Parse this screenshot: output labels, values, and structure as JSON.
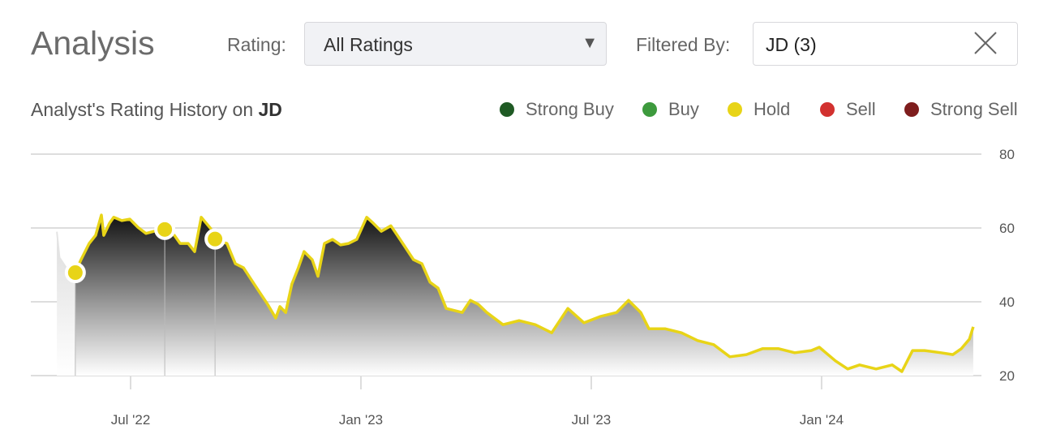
{
  "header": {
    "title": "Analysis",
    "rating_label": "Rating:",
    "rating_value": "All Ratings",
    "filter_label": "Filtered By:",
    "filter_value": "JD (3)"
  },
  "chart_title": {
    "prefix": "Analyst's Rating History on ",
    "ticker": "JD"
  },
  "legend": [
    {
      "label": "Strong Buy",
      "color": "#1f5a24"
    },
    {
      "label": "Buy",
      "color": "#3d9a3d"
    },
    {
      "label": "Hold",
      "color": "#e8d417"
    },
    {
      "label": "Sell",
      "color": "#d2312f"
    },
    {
      "label": "Strong Sell",
      "color": "#7e1d1d"
    }
  ],
  "chart_data": {
    "type": "line",
    "title": "Analyst's Rating History on JD",
    "x_unit": "months since Jul 2022",
    "xlim": [
      -1.92,
      21.95
    ],
    "ylim": [
      20,
      80
    ],
    "yticks": [
      20,
      40,
      60,
      80
    ],
    "xticks": [
      {
        "x": 0,
        "label": "Jul '22"
      },
      {
        "x": 6,
        "label": "Jan '23"
      },
      {
        "x": 12,
        "label": "Jul '23"
      },
      {
        "x": 18,
        "label": "Jan '24"
      }
    ],
    "line_color": "#e8d417",
    "pre_series": [
      [
        -1.92,
        59
      ],
      [
        -1.85,
        52
      ],
      [
        -1.6,
        48
      ],
      [
        -1.44,
        47.9
      ]
    ],
    "series": [
      [
        -1.44,
        47.9
      ],
      [
        -1.29,
        51.4
      ],
      [
        -1.08,
        55.8
      ],
      [
        -0.91,
        58
      ],
      [
        -0.76,
        63.5
      ],
      [
        -0.7,
        58
      ],
      [
        -0.55,
        61.3
      ],
      [
        -0.44,
        62.9
      ],
      [
        -0.23,
        62
      ],
      [
        -0.02,
        62.4
      ],
      [
        0.19,
        60.2
      ],
      [
        0.4,
        58.5
      ],
      [
        0.61,
        59.1
      ],
      [
        0.89,
        59.6
      ],
      [
        1.14,
        58
      ],
      [
        1.29,
        55.8
      ],
      [
        1.5,
        55.8
      ],
      [
        1.67,
        53.6
      ],
      [
        1.84,
        62.9
      ],
      [
        2.09,
        59.8
      ],
      [
        2.22,
        56.7
      ],
      [
        2.51,
        55.8
      ],
      [
        2.73,
        50.3
      ],
      [
        2.94,
        49.2
      ],
      [
        3.15,
        45.9
      ],
      [
        3.36,
        42.6
      ],
      [
        3.57,
        39.3
      ],
      [
        3.78,
        35.6
      ],
      [
        3.89,
        38.7
      ],
      [
        4.04,
        37.1
      ],
      [
        4.2,
        44.8
      ],
      [
        4.37,
        49.2
      ],
      [
        4.52,
        53.6
      ],
      [
        4.73,
        51.4
      ],
      [
        4.88,
        46.9
      ],
      [
        5.05,
        55.8
      ],
      [
        5.26,
        56.9
      ],
      [
        5.47,
        55.4
      ],
      [
        5.68,
        55.8
      ],
      [
        5.89,
        56.9
      ],
      [
        6.15,
        62.9
      ],
      [
        6.32,
        61.3
      ],
      [
        6.53,
        59.1
      ],
      [
        6.78,
        60.6
      ],
      [
        6.95,
        58
      ],
      [
        7.16,
        54.7
      ],
      [
        7.37,
        51.4
      ],
      [
        7.59,
        50.3
      ],
      [
        7.8,
        45.3
      ],
      [
        8.01,
        43.7
      ],
      [
        8.22,
        38.2
      ],
      [
        8.64,
        37.1
      ],
      [
        8.85,
        40.4
      ],
      [
        9.06,
        39.3
      ],
      [
        9.28,
        37.1
      ],
      [
        9.7,
        33.8
      ],
      [
        10.12,
        34.9
      ],
      [
        10.54,
        33.8
      ],
      [
        10.97,
        31.6
      ],
      [
        11.39,
        38.2
      ],
      [
        11.81,
        34.3
      ],
      [
        12.23,
        36
      ],
      [
        12.66,
        37.1
      ],
      [
        12.97,
        40.4
      ],
      [
        13.29,
        37.1
      ],
      [
        13.5,
        32.7
      ],
      [
        13.92,
        32.7
      ],
      [
        14.35,
        31.6
      ],
      [
        14.77,
        29.5
      ],
      [
        15.19,
        28.4
      ],
      [
        15.61,
        25.1
      ],
      [
        16.04,
        25.7
      ],
      [
        16.46,
        27.3
      ],
      [
        16.88,
        27.3
      ],
      [
        17.3,
        26.2
      ],
      [
        17.73,
        26.8
      ],
      [
        17.94,
        27.7
      ],
      [
        18.36,
        24
      ],
      [
        18.68,
        21.8
      ],
      [
        18.99,
        22.9
      ],
      [
        19.42,
        21.8
      ],
      [
        19.84,
        22.9
      ],
      [
        20.09,
        21.1
      ],
      [
        20.37,
        26.8
      ],
      [
        20.68,
        26.8
      ],
      [
        21.11,
        26.2
      ],
      [
        21.42,
        25.7
      ],
      [
        21.64,
        27.3
      ],
      [
        21.85,
        29.9
      ],
      [
        21.95,
        33.2
      ]
    ],
    "ratings": [
      {
        "x": -1.44,
        "y": 47.9,
        "rating": "Hold"
      },
      {
        "x": 0.89,
        "y": 59.6,
        "rating": "Hold"
      },
      {
        "x": 2.2,
        "y": 57,
        "rating": "Hold"
      }
    ]
  }
}
